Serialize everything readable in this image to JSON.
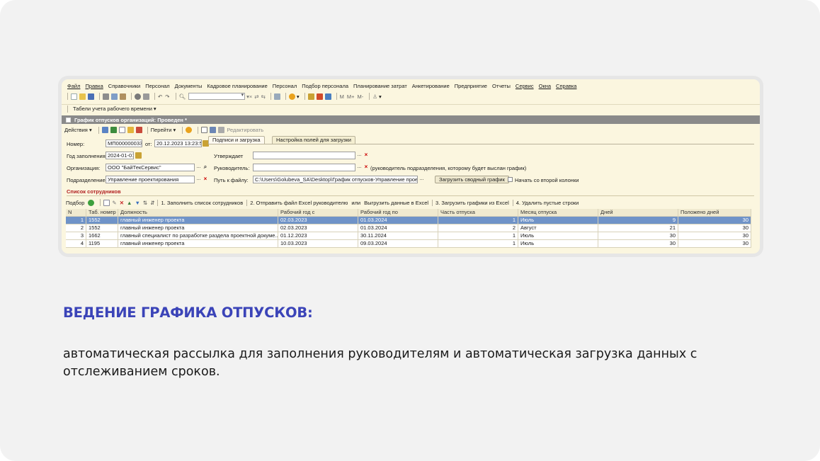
{
  "menu": [
    "Файл",
    "Правка",
    "Справочники",
    "Персонал",
    "Документы",
    "Кадровое планирование",
    "Персонал",
    "Подбор персонала",
    "Планирование затрат",
    "Анкетирование",
    "Предприятие",
    "Отчеты",
    "Сервис",
    "Окна",
    "Справка"
  ],
  "toolbar_labels": [
    "M",
    "M+",
    "M-"
  ],
  "panel_label": "Табели учета рабочего времени",
  "doc_title": "График отпусков организаций: Проведен *",
  "actions": {
    "actions_label": "Действия",
    "goto_label": "Перейти",
    "edit_label": "Редактировать"
  },
  "form": {
    "number_label": "Номер:",
    "number_value": "МП000000033",
    "from_label": "от:",
    "date_value": "20.12.2023 13:23:57",
    "year_label": "Год заполнения:",
    "year_value": "2024-01-01",
    "org_label": "Организация:",
    "org_value": "ООО \"БайТекСервис\"",
    "dept_label": "Подразделение:",
    "dept_value": "Управление проектирования"
  },
  "tabs": [
    "Подписи и загрузка",
    "Настройка полей для загрузки"
  ],
  "right_form": {
    "approves_label": "Утверждает",
    "manager_label": "Руководитель:",
    "manager_note": "(руководитель подразделения, которому будет выслан график)",
    "path_label": "Путь к файлу:",
    "path_value": "C:\\Users\\Golubeva_SA\\Desktop\\График отпусков-Управление проект",
    "load_button": "Загрузить сводный график",
    "second_col_label": "Начать со второй колонки"
  },
  "section_title": "Список сотрудников",
  "list_toolbar": {
    "pick_label": "Подбор",
    "step1": "1. Заполнить список сотрудников",
    "step2": "2. Отправить файл Excel руководителю",
    "or_label": "или",
    "unload": "Выгрузить данные в Excel",
    "step3": "3. Загрузить графики из Excel",
    "step4": "4. Удалить пустые строки"
  },
  "table": {
    "headers": [
      "N",
      "Таб. номер",
      "Должность",
      "Рабочий год с",
      "Рабочий год по",
      "Часть отпуска",
      "Месяц отпуска",
      "Дней",
      "Положено дней"
    ],
    "rows": [
      [
        "1",
        "1552",
        "главный инженер проекта",
        "02.03.2023",
        "01.03.2024",
        "1",
        "Июль",
        "9",
        "30"
      ],
      [
        "2",
        "1552",
        "главный инженер проекта",
        "02.03.2023",
        "01.03.2024",
        "2",
        "Август",
        "21",
        "30"
      ],
      [
        "3",
        "1662",
        "главный специалист по разработке раздела проектной докуме...",
        "01.12.2023",
        "30.11.2024",
        "1",
        "Июль",
        "30",
        "30"
      ],
      [
        "4",
        "1195",
        "главный инженер проекта",
        "10.03.2023",
        "09.03.2024",
        "1",
        "Июль",
        "30",
        "30"
      ]
    ],
    "selected_row": 0
  },
  "slide": {
    "heading": "ВЕДЕНИЕ ГРАФИКА ОТПУСКОВ:",
    "body": "автоматическая рассылка для заполнения руководителям и автоматическая загрузка данных с отслеживанием сроков."
  },
  "colors": {
    "heading": "#3b44b8",
    "app_bg": "#fbf6df",
    "selected_row": "#6f93c8",
    "title_bar": "#8a8a8a"
  }
}
